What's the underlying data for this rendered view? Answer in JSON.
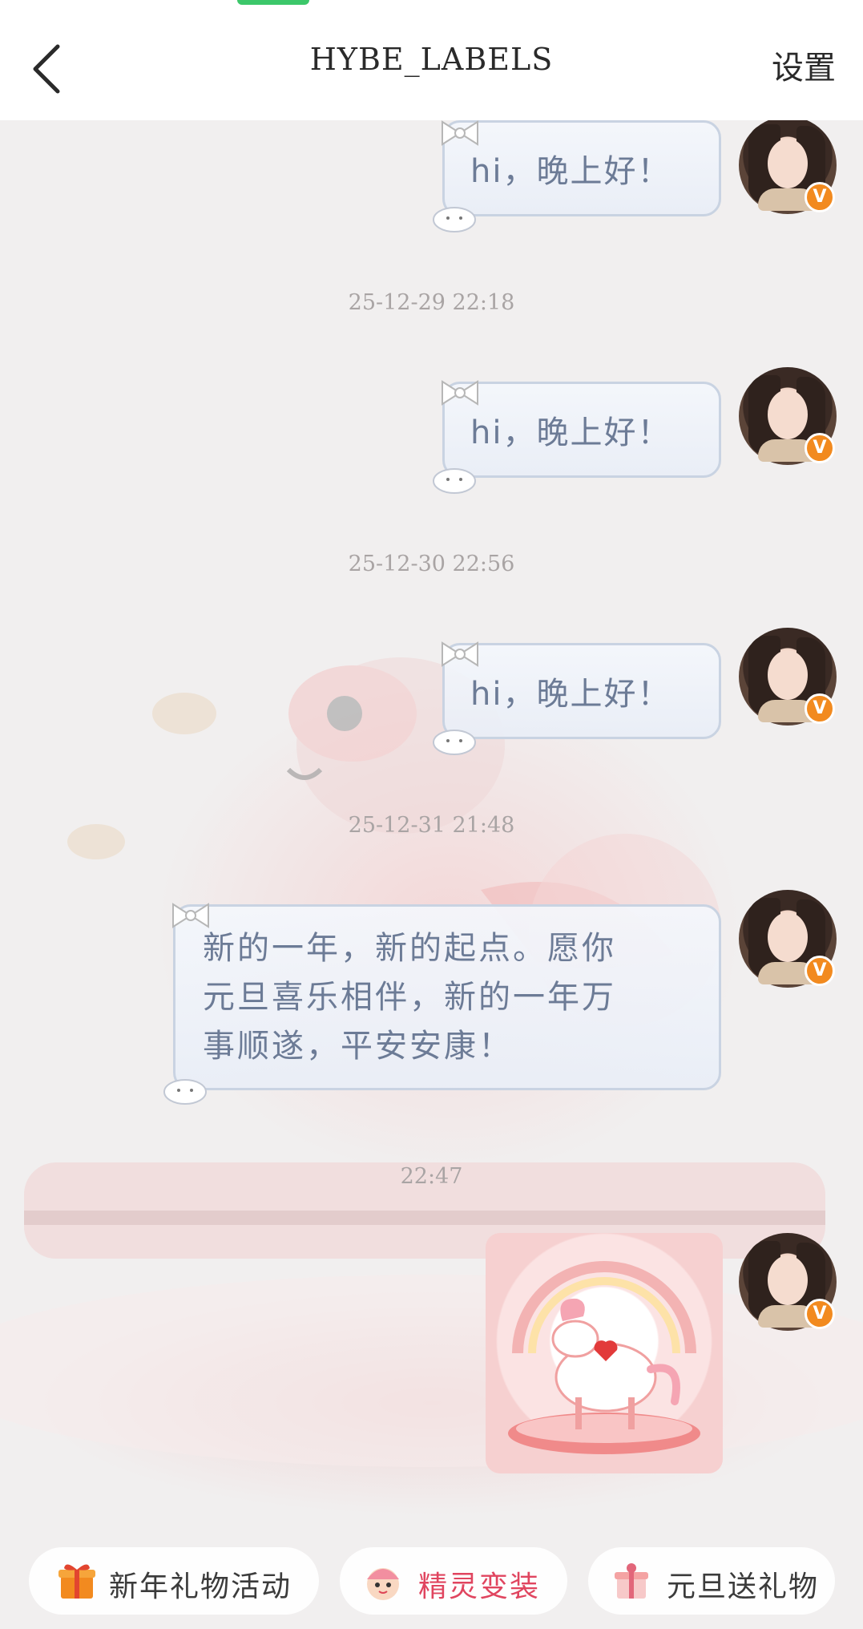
{
  "header": {
    "title": "HYBE_LABELS",
    "settings_label": "设置"
  },
  "messages": [
    {
      "text": "hi，晚上好！"
    },
    {
      "timestamp": "25-12-29 22:18",
      "text": "hi，晚上好！"
    },
    {
      "timestamp": "25-12-30 22:56",
      "text": "hi，晚上好！"
    },
    {
      "timestamp": "25-12-31 21:48",
      "lines": [
        "新的一年，新的起点。愿你",
        "元旦喜乐相伴，新的一年万",
        "事顺遂，平安安康！"
      ]
    },
    {
      "timestamp": "22:47",
      "type": "sticker",
      "sticker_icon": "unicorn-heart-sticker"
    }
  ],
  "avatar": {
    "badge_text": "V",
    "badge_color": "#f28a1f"
  },
  "actions": [
    {
      "label": "新年礼物活动",
      "icon": "gift-icon",
      "color": "#3b3b3b"
    },
    {
      "label": "精灵变装",
      "icon": "sprite-dressup-icon",
      "color": "#e0455f"
    },
    {
      "label": "元旦送礼物",
      "icon": "gift-box-icon",
      "color": "#3b3b3b"
    }
  ],
  "colors": {
    "status_pill": "#3cc76a",
    "bubble_border": "#c9d3e2",
    "bubble_text": "#6c7b96",
    "timestamp": "#a9a4a4"
  }
}
